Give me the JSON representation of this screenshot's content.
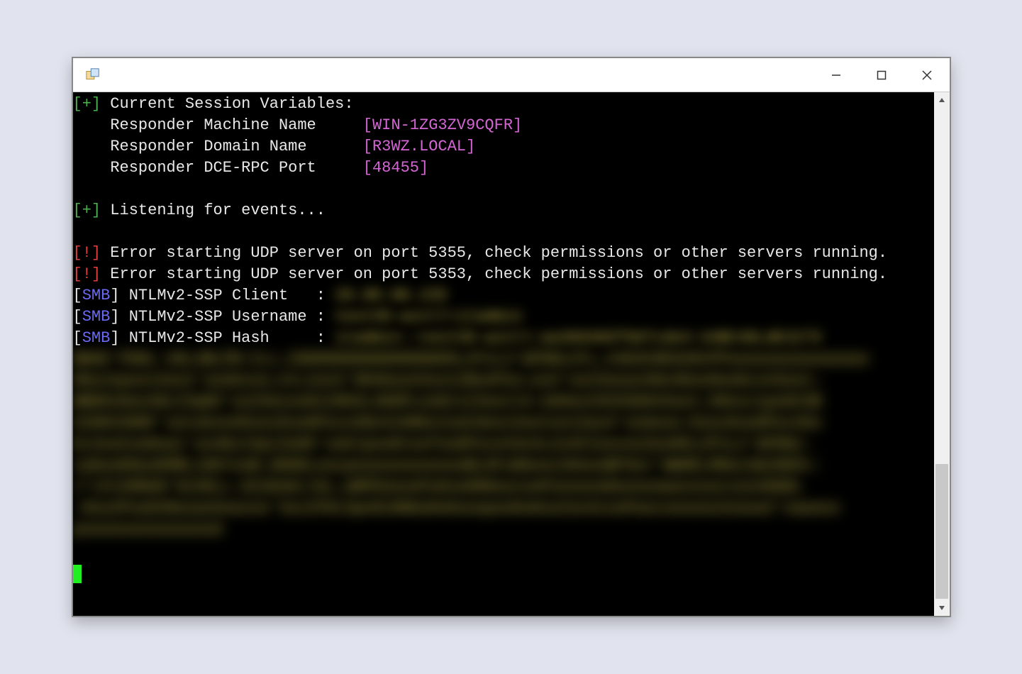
{
  "prefixes": {
    "plus": "[+]",
    "bang": "[!]",
    "smb_open": "[",
    "smb_label": "SMB",
    "smb_close": "]"
  },
  "session": {
    "header": " Current Session Variables:",
    "machine_label": "    Responder Machine Name     ",
    "machine_value": "[WIN-1ZG3ZV9CQFR]",
    "domain_label": "    Responder Domain Name      ",
    "domain_value": "[R3WZ.LOCAL]",
    "port_label": "    Responder DCE-RPC Port     ",
    "port_value": "[48455]"
  },
  "listening": " Listening for events...",
  "errors": {
    "e1": " Error starting UDP server on port 5355, check permissions or other servers running.",
    "e2": " Error starting UDP server on port 5353, check permissions or other servers running."
  },
  "smb": {
    "client_label": " NTLMv2-SSP Client   : ",
    "username_label": " NTLMv2-SSP Username : ",
    "hash_label": " NTLMv2-SSP Hash     : ",
    "client_value_redacted": "20.80.88.235",
    "username_value_redacted": "testVD-winll\\itadmin",
    "hash_value_redacted": "itadmin::testVD-winll:aa369365f9d7cde4:44BC4DLdE3275"
  },
  "hash_block_redacted": "BBAE'PDNL:4DL4BLPB:CLL;200000000000000005L2F1L3'&PDNLCFL;4303C0E92KCPPooooooooooooooo\n0bockpoo13oo2'ooSAzoo;otL2oo3'004boo#Zoo12NooPoo;oo4'oo23oooo36o4boo9oobco43oot;\nBBD010oo48c23q05'oo2SAzoo012003L3GOPLoo8c123oot14:ob9oo43CO3b043oot;99oxc1po023B\n52003300F'ootakoo#EoocEoo6Poce3Do41986cCooCdoo14ootoo13oo4'ooAooo:EoocEoo6Pocd3o\nKL5ooCooDoa1'oo48c23p13o05'ooblpoo8toofoo6Poce43o4L2o4CIoovoo3oo05L2P1L2'&PDNz:\n1aDooENooEMNL1807ooB:dGODLoocpooooooooooooBL6FuNAooLb9oooBF9ot'WWHELMDeLb&2005t:\nJ'LPc58RAN'%23DLL:d22DoKLYáL;aBPEAoooPuKoo800oocooPooooooDooooowoosooc1oo4GODL\n:9oo2PooD2Nooaokeasoo'3oz2FDc3po010NGoDoKooopooDuKoo2oo4cooPaocoooooo2oooe2'oaaoox\npooooooooooooood"
}
